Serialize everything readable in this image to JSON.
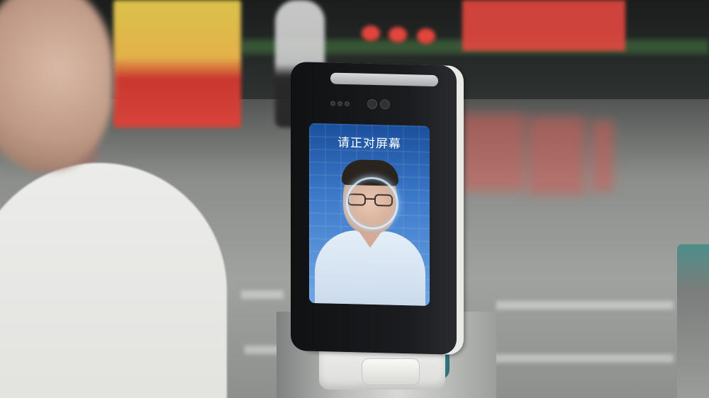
{
  "screen": {
    "prompt_text": "请正对屏幕"
  },
  "colors": {
    "screen_blue": "#3c79c9",
    "stand_teal": "#2c7f86",
    "scan_ring": "#dcf0ff"
  },
  "icons": [
    "camera-icon",
    "face-scan-ring-icon"
  ]
}
